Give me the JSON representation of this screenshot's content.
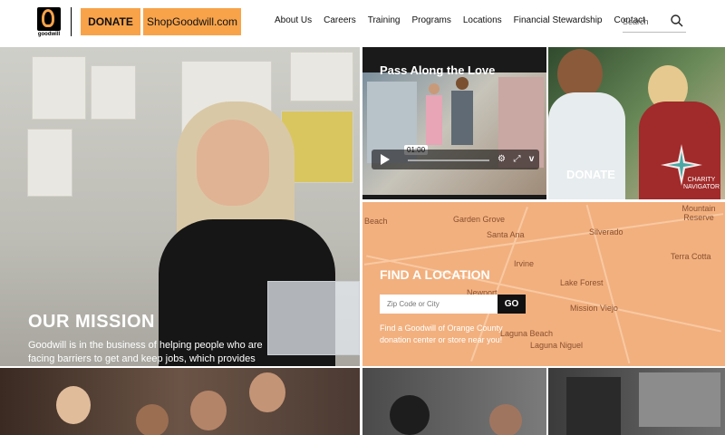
{
  "header": {
    "logo_text": "goodwill",
    "donate_label": "DONATE",
    "shop_label": "ShopGoodwill.com",
    "nav": [
      "About Us",
      "Careers",
      "Training",
      "Programs",
      "Locations",
      "Financial Stewardship",
      "Contact"
    ],
    "search_placeholder": "Search"
  },
  "mission": {
    "title": "OUR MISSION",
    "text": "Goodwill is in the business of helping people who are facing barriers to get and keep jobs, which provides purpose, pride and dignity. We believe the power of work changes lives."
  },
  "video": {
    "title": "Pass Along the Love",
    "time": "01:00"
  },
  "donate_tile": {
    "label": "DONATE",
    "badge": "CHARITY NAVIGATOR"
  },
  "location": {
    "title": "FIND A LOCATION",
    "placeholder": "Zip Code or City",
    "go_label": "GO",
    "text": "Find a Goodwill of Orange County donation center or store near you!",
    "map_labels": [
      "Beach",
      "Garden Grove",
      "Santa Ana",
      "Irvine",
      "Newport",
      "Lake Forest",
      "Mission Viejo",
      "Laguna Beach",
      "Laguna Niguel",
      "Silverado",
      "Mountain Reserve",
      "Terra Cotta"
    ]
  },
  "colors": {
    "accent": "#f8a34a",
    "map": "#f2b07e"
  }
}
